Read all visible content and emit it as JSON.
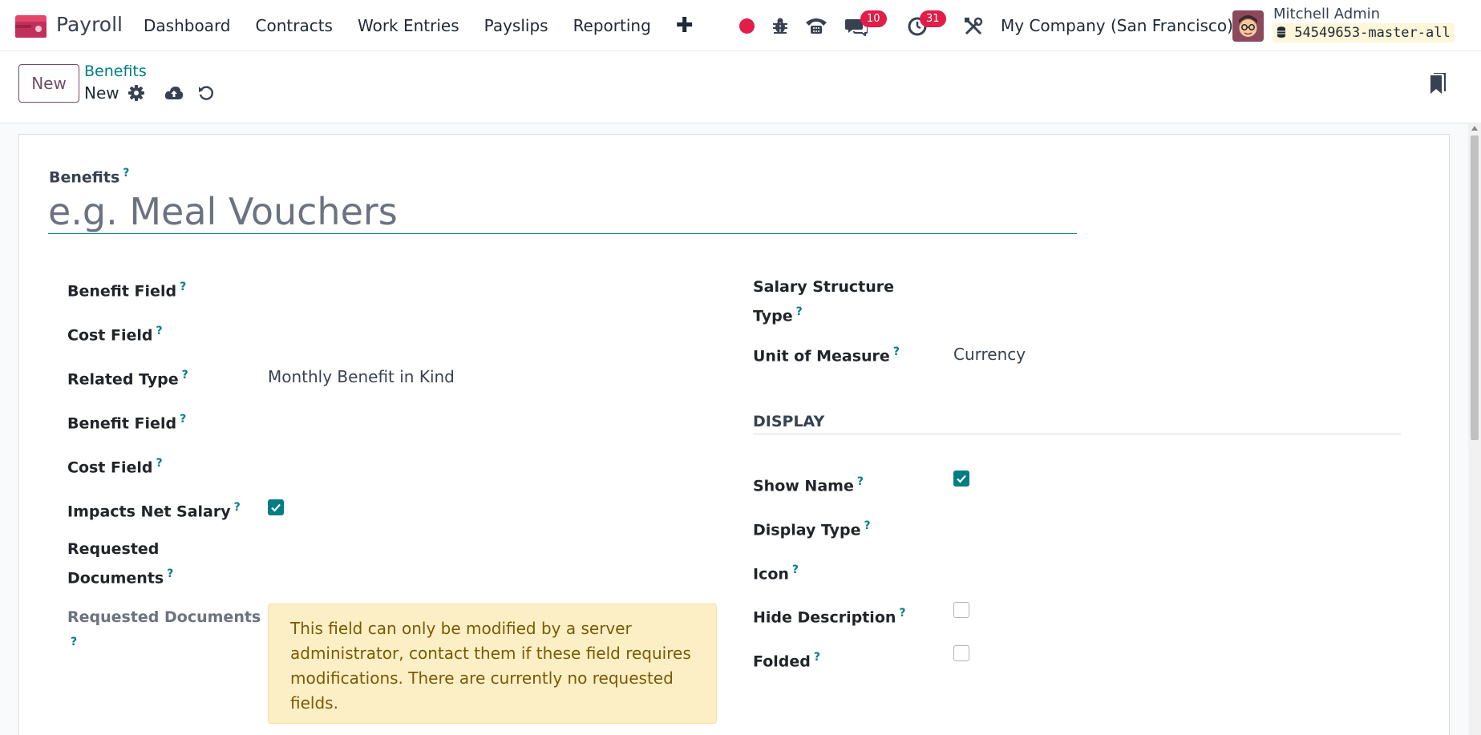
{
  "navbar": {
    "app_name": "Payroll",
    "menu": [
      "Dashboard",
      "Contracts",
      "Work Entries",
      "Payslips",
      "Reporting"
    ],
    "plus_label": "✚",
    "messages_count": "10",
    "activities_count": "31",
    "company": "My Company (San Francisco)",
    "user_name": "Mitchell Admin",
    "db_name": "54549653-master-all"
  },
  "control": {
    "new_label": "New",
    "breadcrumb_parent": "Benefits",
    "breadcrumb_current": "New"
  },
  "form": {
    "title_label": "Benefits",
    "title_placeholder": "e.g. Meal Vouchers",
    "help": "?",
    "left": {
      "benefit_field": "Benefit Field",
      "cost_field": "Cost Field",
      "related_type": "Related Type",
      "related_type_value": "Monthly Benefit in Kind",
      "benefit_field_2": "Benefit Field",
      "cost_field_2": "Cost Field",
      "impacts_net_salary": "Impacts Net Salary",
      "impacts_net_salary_checked": true,
      "requested_documents_line1": "Requested",
      "requested_documents_line2": "Documents",
      "requested_documents_muted": "Requested Documents",
      "alert_text": "This field can only be modified by a server administrator, contact them if these field requires modifications. There are currently no requested fields."
    },
    "right": {
      "salary_structure_line1": "Salary Structure",
      "salary_structure_line2": "Type",
      "unit_of_measure": "Unit of Measure",
      "unit_of_measure_value": "Currency",
      "display_section": "DISPLAY",
      "show_name": "Show Name",
      "show_name_checked": true,
      "display_type": "Display Type",
      "icon": "Icon",
      "hide_description": "Hide Description",
      "hide_description_checked": false,
      "folded": "Folded",
      "folded_checked": false
    }
  },
  "colors": {
    "brand": "#714b67",
    "accent": "#017e84",
    "badge": "#e11d48",
    "alert_bg": "#fcefc6"
  },
  "icons": [
    "payroll-app-icon",
    "record-icon",
    "bug-icon",
    "phone-icon",
    "chat-icon",
    "clock-icon",
    "tools-icon",
    "database-icon",
    "gear-icon",
    "cloud-upload-icon",
    "undo-icon",
    "bookmark-icon",
    "checkmark-icon"
  ]
}
